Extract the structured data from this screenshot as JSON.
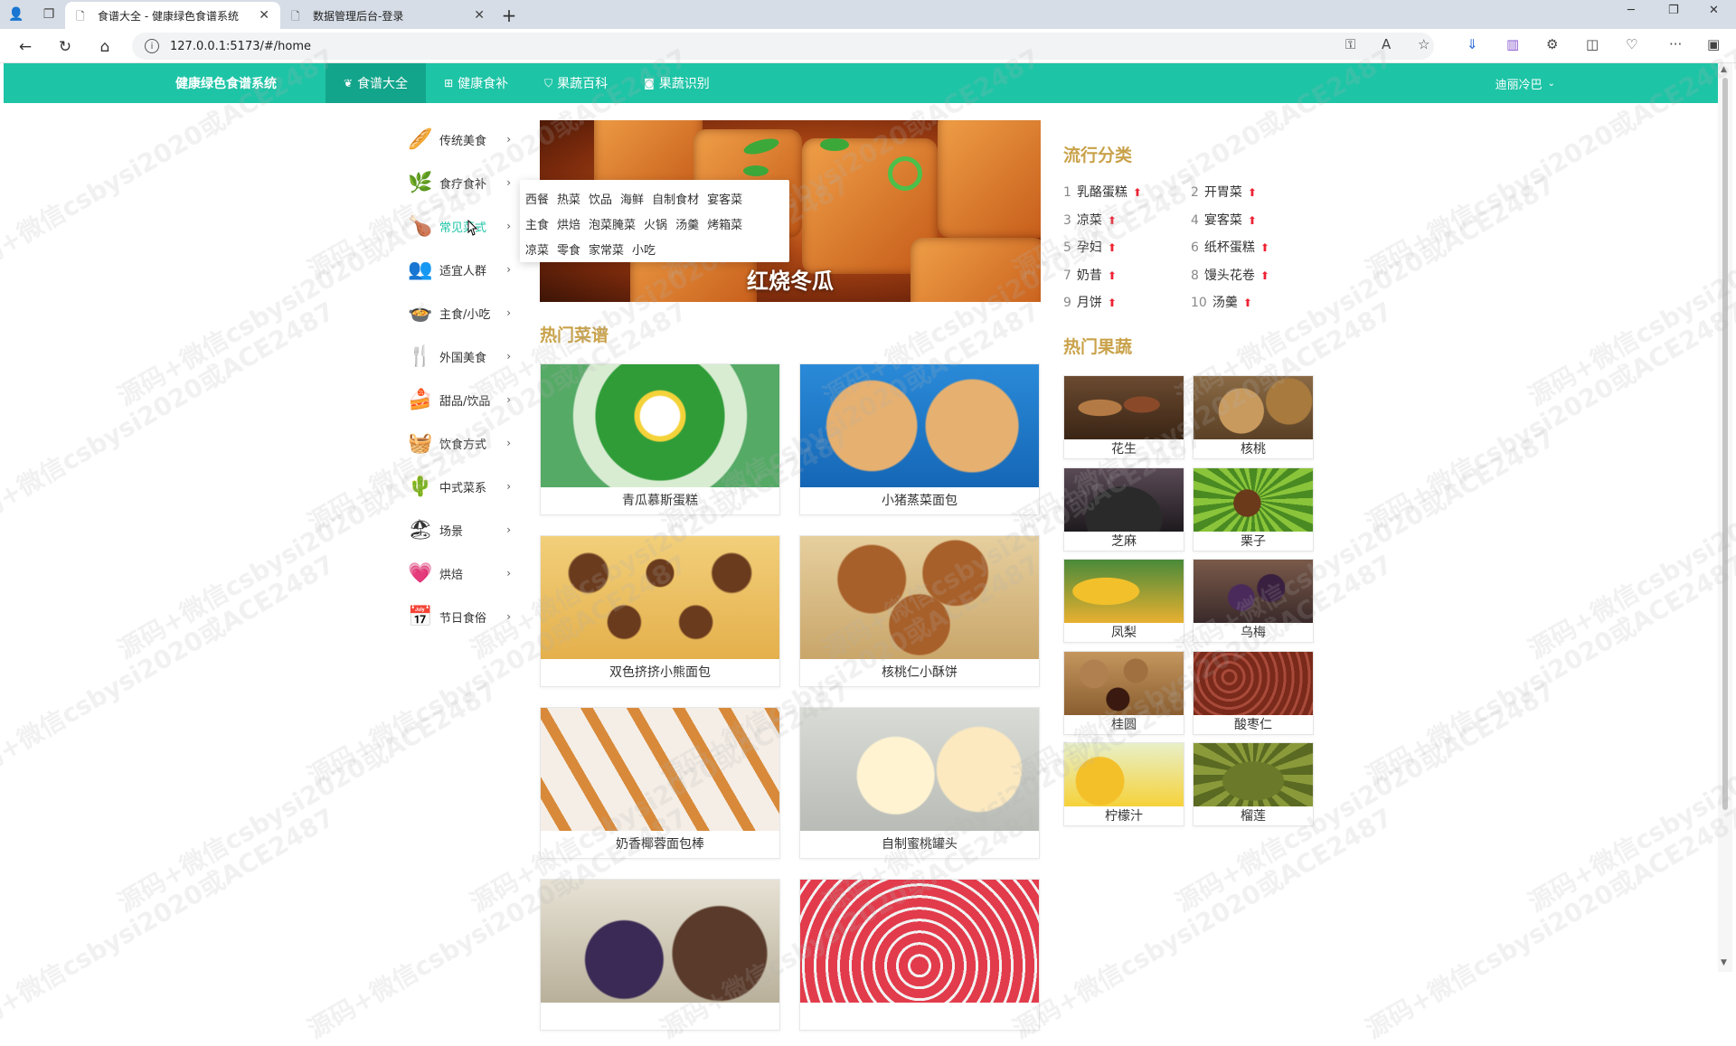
{
  "browser": {
    "tabs": [
      {
        "title": "食谱大全 - 健康绿色食谱系统",
        "active": true
      },
      {
        "title": "数据管理后台-登录",
        "active": false
      }
    ],
    "url": "127.0.0.1:5173/#/home"
  },
  "appnav": {
    "brand": "健康绿色食谱系统",
    "items": [
      {
        "label": "食谱大全",
        "icon": "leaf-icon",
        "active": true
      },
      {
        "label": "健康食补",
        "icon": "grid-icon",
        "active": false
      },
      {
        "label": "果蔬百科",
        "icon": "shield-icon",
        "active": false
      },
      {
        "label": "果蔬识别",
        "icon": "camera-icon",
        "active": false
      }
    ],
    "user": "迪丽冷巴"
  },
  "categories": [
    {
      "label": "传统美食",
      "icon": "bread-icon",
      "glyph": "🥖"
    },
    {
      "label": "食疗食补",
      "icon": "herb-icon",
      "glyph": "🌿"
    },
    {
      "label": "常见菜式",
      "icon": "roast-chicken-icon",
      "glyph": "🍗",
      "active": true
    },
    {
      "label": "适宜人群",
      "icon": "people-icon",
      "glyph": "👥"
    },
    {
      "label": "主食/小吃",
      "icon": "bowl-icon",
      "glyph": "🍲"
    },
    {
      "label": "外国美食",
      "icon": "cutlery-icon",
      "glyph": "🍴"
    },
    {
      "label": "甜品/饮品",
      "icon": "cake-icon",
      "glyph": "🍰"
    },
    {
      "label": "饮食方式",
      "icon": "basket-icon",
      "glyph": "🧺"
    },
    {
      "label": "中式菜系",
      "icon": "cactus-icon",
      "glyph": "🌵"
    },
    {
      "label": "场景",
      "icon": "beach-icon",
      "glyph": "🏖"
    },
    {
      "label": "烘焙",
      "icon": "heart-icon",
      "glyph": "💗"
    },
    {
      "label": "节日食俗",
      "icon": "calendar-icon",
      "glyph": "📅"
    }
  ],
  "submenu": [
    [
      "西餐",
      "热菜",
      "饮品",
      "海鲜",
      "自制食材",
      "宴客菜"
    ],
    [
      "主食",
      "烘焙",
      "泡菜腌菜",
      "火锅",
      "汤羹",
      "烤箱菜"
    ],
    [
      "凉菜",
      "零食",
      "家常菜",
      "小吃"
    ]
  ],
  "banner": {
    "title": "红烧冬瓜"
  },
  "hot_recipes": {
    "title": "热门菜谱",
    "items": [
      {
        "name": "青瓜慕斯蛋糕"
      },
      {
        "name": "小猪蒸菜面包"
      },
      {
        "name": "双色挤挤小熊面包"
      },
      {
        "name": "核桃仁小酥饼"
      },
      {
        "name": "奶香椰蓉面包棒"
      },
      {
        "name": "自制蜜桃罐头"
      },
      {
        "name": ""
      },
      {
        "name": ""
      }
    ]
  },
  "trending": {
    "title": "流行分类",
    "items": [
      {
        "num": "1",
        "label": "乳酪蛋糕"
      },
      {
        "num": "2",
        "label": "开胃菜"
      },
      {
        "num": "3",
        "label": "凉菜"
      },
      {
        "num": "4",
        "label": "宴客菜"
      },
      {
        "num": "5",
        "label": "孕妇"
      },
      {
        "num": "6",
        "label": "纸杯蛋糕"
      },
      {
        "num": "7",
        "label": "奶昔"
      },
      {
        "num": "8",
        "label": "馒头花卷"
      },
      {
        "num": "9",
        "label": "月饼"
      },
      {
        "num": "10",
        "label": "汤羹"
      }
    ]
  },
  "hot_fruits": {
    "title": "热门果蔬",
    "items": [
      {
        "name": "花生"
      },
      {
        "name": "核桃"
      },
      {
        "name": "芝麻"
      },
      {
        "name": "栗子"
      },
      {
        "name": "凤梨"
      },
      {
        "name": "乌梅"
      },
      {
        "name": "桂圆"
      },
      {
        "name": "酸枣仁"
      },
      {
        "name": "柠檬汁"
      },
      {
        "name": "榴莲"
      }
    ]
  },
  "watermark": "源码+微信csbysi2020或ACE2487"
}
